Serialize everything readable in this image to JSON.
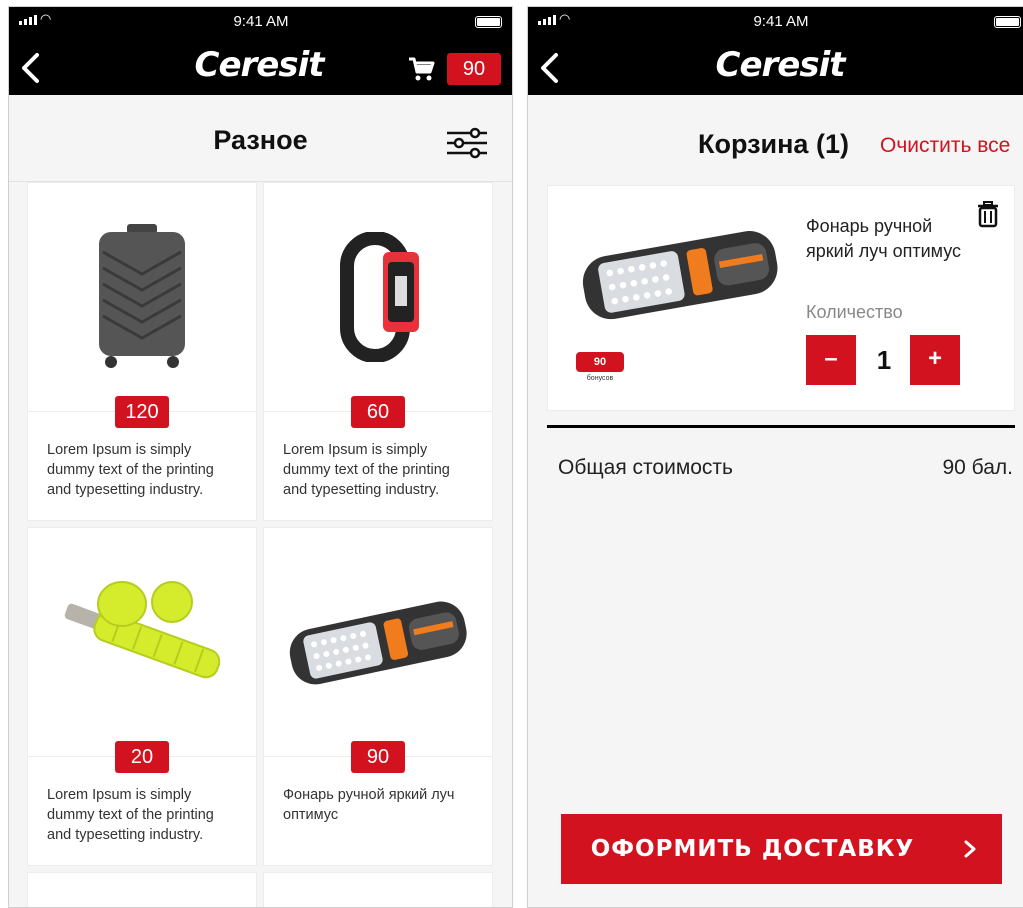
{
  "status_bar": {
    "time": "9:41 AM"
  },
  "brand": {
    "logo_text": "Ceresit",
    "accent": "#d2121e",
    "bar_bg": "#000000"
  },
  "catalog": {
    "title": "Разное",
    "cart_count": "90",
    "icons": {
      "back": "chevron-left-icon",
      "cart": "cart-icon",
      "filter": "sliders-icon"
    },
    "products": [
      {
        "price": "120",
        "description": "Lorem Ipsum is simply dummy text of the printing and typesetting industry.",
        "image": "suitcase"
      },
      {
        "price": "60",
        "description": "Lorem Ipsum is simply dummy text of the printing and typesetting industry.",
        "image": "fitness-band"
      },
      {
        "price": "20",
        "description": "Lorem Ipsum is simply dummy text of the printing and typesetting industry.",
        "image": "ankle-weights"
      },
      {
        "price": "90",
        "description": "Фонарь ручной яркий луч оптимус",
        "image": "flashlight"
      }
    ]
  },
  "cart": {
    "title": "Корзина (1)",
    "clear_all": "Очистить все",
    "item": {
      "name": "Фонарь ручной яркий луч оптимус",
      "bonus_value": "90",
      "bonus_label": "бонусов",
      "quantity_label": "Количество",
      "quantity": "1",
      "minus": "–",
      "plus": "+",
      "image": "flashlight"
    },
    "total_label": "Общая стоимость",
    "total_value": "90 бал.",
    "checkout_label": "ОФОРМИТЬ ДОСТАВКУ",
    "icons": {
      "delete": "trash-icon",
      "checkout_arrow": "chevron-right-icon"
    }
  }
}
